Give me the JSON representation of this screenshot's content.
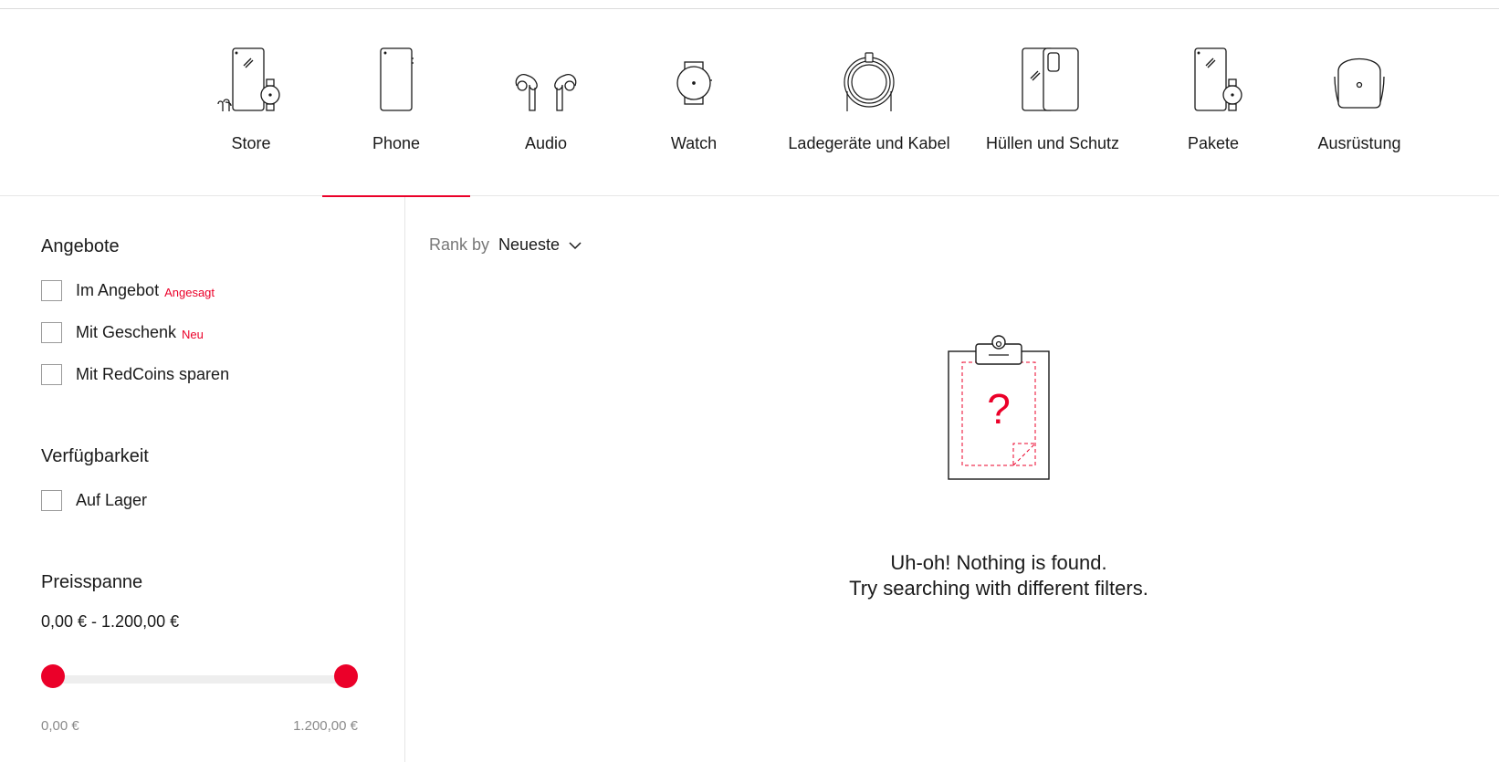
{
  "nav": {
    "categories": [
      {
        "label": "Store",
        "icon": "store-icon"
      },
      {
        "label": "Phone",
        "icon": "phone-icon",
        "active": true
      },
      {
        "label": "Audio",
        "icon": "earbuds-icon"
      },
      {
        "label": "Watch",
        "icon": "watch-icon"
      },
      {
        "label": "Ladegeräte und Kabel",
        "icon": "cable-icon"
      },
      {
        "label": "Hüllen und Schutz",
        "icon": "phone-case-icon"
      },
      {
        "label": "Pakete",
        "icon": "bundle-icon"
      },
      {
        "label": "Ausrüstung",
        "icon": "backpack-icon"
      }
    ],
    "active_color": "#eb0029"
  },
  "filters": {
    "offers": {
      "title": "Angebote",
      "items": [
        {
          "label": "Im Angebot",
          "tag": "Angesagt",
          "checked": false
        },
        {
          "label": "Mit Geschenk",
          "tag": "Neu",
          "checked": false
        },
        {
          "label": "Mit RedCoins sparen",
          "tag": "",
          "checked": false
        }
      ]
    },
    "availability": {
      "title": "Verfügbarkeit",
      "items": [
        {
          "label": "Auf Lager",
          "checked": false
        }
      ]
    },
    "price": {
      "title": "Preisspanne",
      "range_text": "0,00 € - 1.200,00 €",
      "min_label": "0,00 €",
      "max_label": "1.200,00 €",
      "min_value": 0,
      "max_value": 1200
    }
  },
  "sort": {
    "label": "Rank by",
    "value": "Neueste"
  },
  "empty_state": {
    "line1": "Uh-oh! Nothing is found.",
    "line2": "Try searching with different filters.",
    "icon": "clipboard-question-icon",
    "accent": "#eb0029"
  }
}
